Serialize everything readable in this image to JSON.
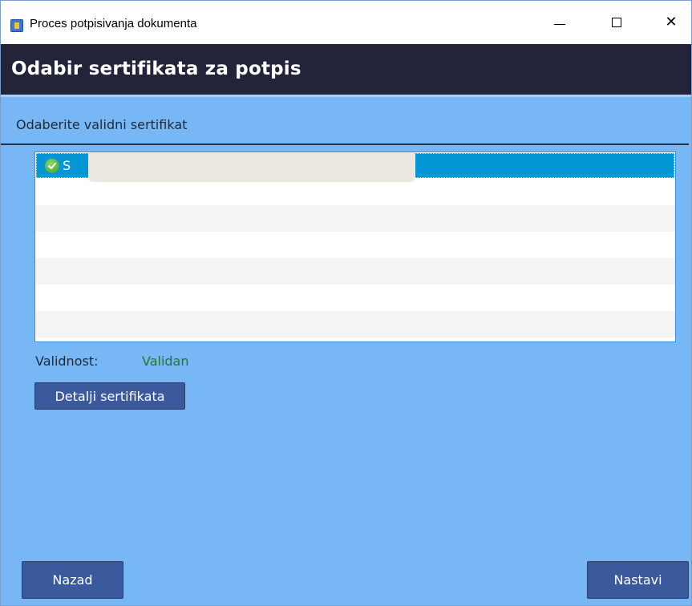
{
  "window": {
    "title": "Proces potpisivanja dokumenta",
    "minimize_glyph": "—",
    "maximize_glyph": "☐",
    "close_glyph": "✕"
  },
  "header": {
    "title": "Odabir sertifikata za potpis"
  },
  "main": {
    "instruction": "Odaberite validni sertifikat",
    "certificates": [
      {
        "name": "S",
        "valid": true,
        "icon": "check-icon",
        "selected": true
      }
    ],
    "validity_label": "Validnost:",
    "validity_value": "Validan",
    "details_button_label": "Detalji sertifikata"
  },
  "footer": {
    "back_label": "Nazad",
    "next_label": "Nastavi"
  },
  "colors": {
    "header_bg": "#23233a",
    "content_bg": "#78b7f5",
    "selected_row": "#0597d5",
    "button_bg": "#3b5a9d",
    "valid_text": "#1f7a2c"
  }
}
